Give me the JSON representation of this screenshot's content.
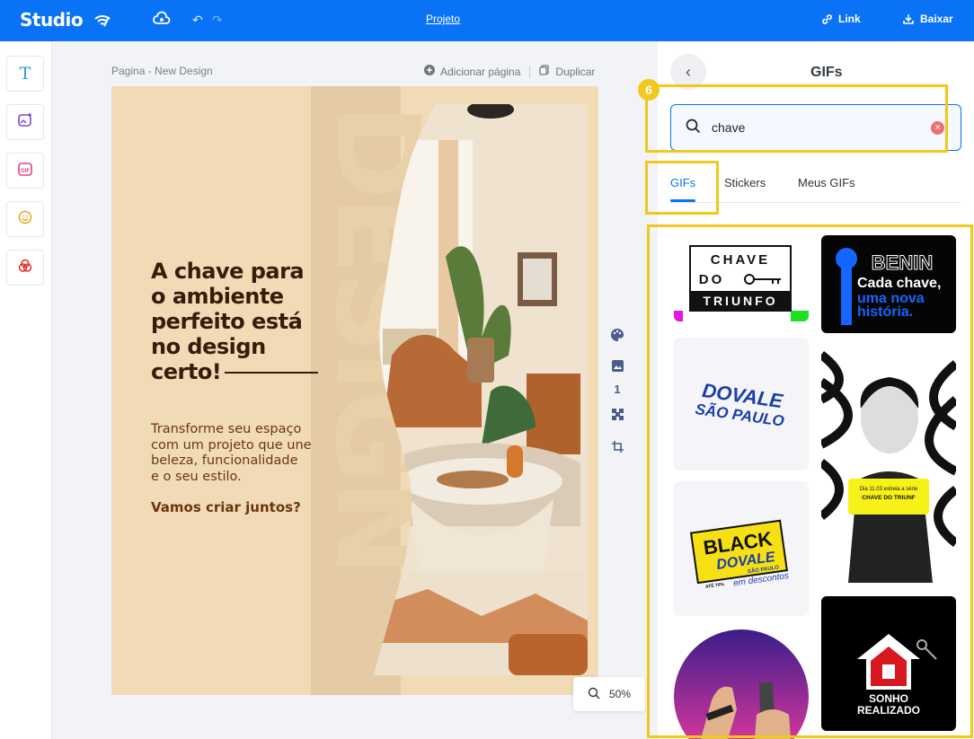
{
  "topbar": {
    "logo": "Studio",
    "project": "Projeto",
    "link_label": "Link",
    "download_label": "Baixar"
  },
  "canvas": {
    "page_label": "Pagina - New Design",
    "add_page": "Adicionar página",
    "duplicate": "Duplicar",
    "page_number": "1",
    "zoom": "50%"
  },
  "design": {
    "background_word": "DESIGN",
    "headline_lines": [
      "A chave para",
      "o ambiente",
      "perfeito está",
      "no design",
      "certo!"
    ],
    "body_lines": [
      "Transforme seu espaço",
      "com um projeto que une",
      "beleza, funcionalidade",
      "e o seu estilo."
    ],
    "cta": "Vamos criar juntos?"
  },
  "panel": {
    "title": "GIFs",
    "step_badge": "6",
    "search_value": "chave",
    "tabs": [
      "GIFs",
      "Stickers",
      "Meus GIFs"
    ],
    "active_tab": "GIFs",
    "gifs": [
      {
        "name": "chave-do-triunfo",
        "lines": [
          "CHAVE",
          "DO",
          "TRIUNFO"
        ]
      },
      {
        "name": "benin-cada-chave",
        "lines": [
          "BENIN",
          "Cada chave,",
          "uma nova",
          "história."
        ]
      },
      {
        "name": "dovale-sao-paulo",
        "lines": [
          "DOVALE",
          "SÃO PAULO"
        ]
      },
      {
        "name": "chave-do-triunf-portrait",
        "lines": [
          "Dia 11.03 estreia a série",
          "CHAVE DO TRIUNF"
        ]
      },
      {
        "name": "black-dovale",
        "lines": [
          "BLACK",
          "DOVALE",
          "SÃO PAULO",
          "em descontos",
          "ATÉ 70%"
        ]
      },
      {
        "name": "hands-keys",
        "lines": []
      },
      {
        "name": "sonho-realizado",
        "lines": [
          "SONHO",
          "REALIZADO"
        ]
      }
    ]
  },
  "colors": {
    "accent": "#0a73f5",
    "highlight": "#f2c81b",
    "design_bg": "#f0dbb6",
    "headline": "#3a1b0a"
  }
}
